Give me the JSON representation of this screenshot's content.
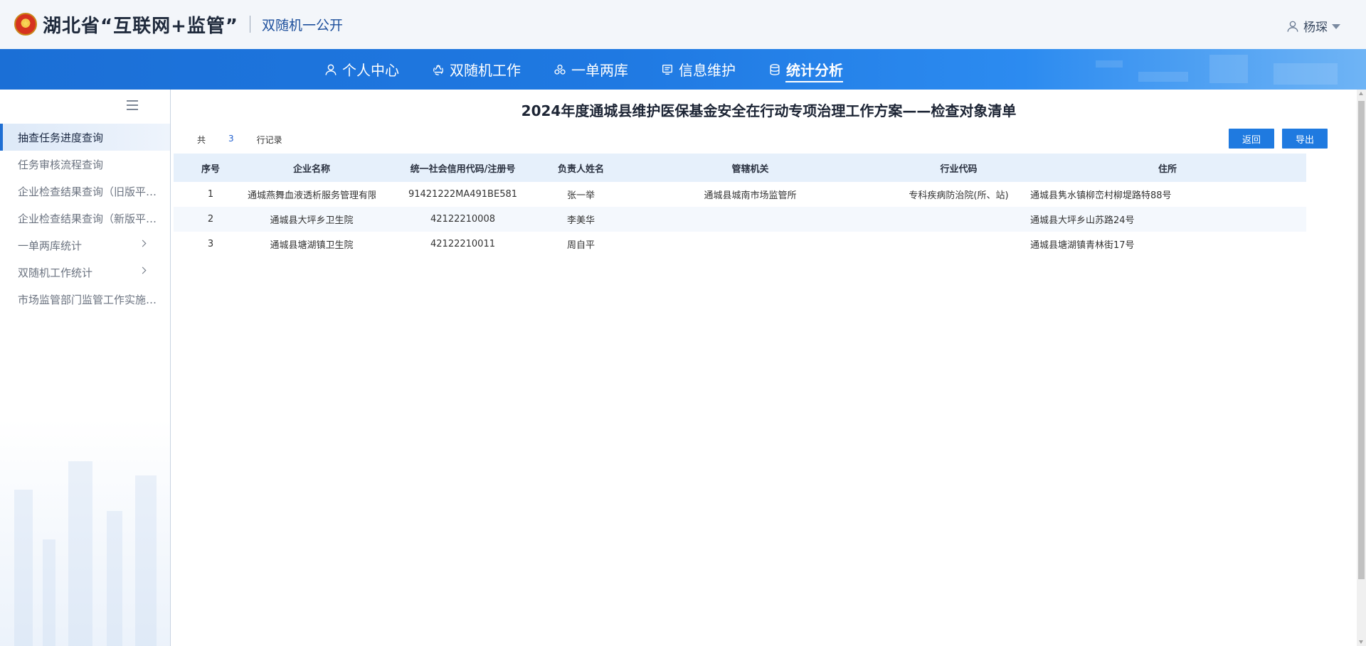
{
  "header": {
    "brand_title": "湖北省“互联网+监管”",
    "brand_sub": "双随机一公开",
    "user_name": "杨琛"
  },
  "nav": {
    "items": [
      {
        "label": "个人中心",
        "icon": "user-icon"
      },
      {
        "label": "双随机工作",
        "icon": "recycle-icon"
      },
      {
        "label": "一单两库",
        "icon": "cluster-icon"
      },
      {
        "label": "信息维护",
        "icon": "document-icon"
      },
      {
        "label": "统计分析",
        "icon": "database-icon",
        "active": true
      }
    ]
  },
  "sidebar": {
    "items": [
      {
        "label": "抽查任务进度查询",
        "active": true
      },
      {
        "label": "任务审核流程查询"
      },
      {
        "label": "企业检查结果查询（旧版平台）"
      },
      {
        "label": "企业检查结果查询（新版平台）"
      },
      {
        "label": "一单两库统计",
        "has_sub": true
      },
      {
        "label": "双随机工作统计",
        "has_sub": true
      },
      {
        "label": "市场监管部门监管工作实施情况"
      }
    ]
  },
  "main": {
    "title": "2024年度通城县维护医保基金安全在行动专项治理工作方案——检查对象清单",
    "count_prefix": "共",
    "count_value": "3",
    "count_suffix": "行记录",
    "back_label": "返回",
    "export_label": "导出"
  },
  "table": {
    "columns": [
      "序号",
      "企业名称",
      "统一社会信用代码/注册号",
      "负责人姓名",
      "管辖机关",
      "行业代码",
      "住所"
    ],
    "rows": [
      [
        "1",
        "通城燕舞血液透析服务管理有限公司",
        "91421222MA491BE581",
        "张一举",
        "通城县城南市场监管所",
        "专科疾病防治院(所、站)",
        "通城县隽水镇柳峦村柳堤路特88号"
      ],
      [
        "2",
        "通城县大坪乡卫生院",
        "42122210008",
        "李美华",
        "",
        "",
        "通城县大坪乡山苏路24号"
      ],
      [
        "3",
        "通城县塘湖镇卫生院",
        "42122210011",
        "周自平",
        "",
        "",
        "通城县塘湖镇青林街17号"
      ]
    ]
  },
  "colors": {
    "nav_blue": "#1f79e2",
    "button_blue": "#1f7ae0",
    "header_row": "#e6f0fb"
  }
}
